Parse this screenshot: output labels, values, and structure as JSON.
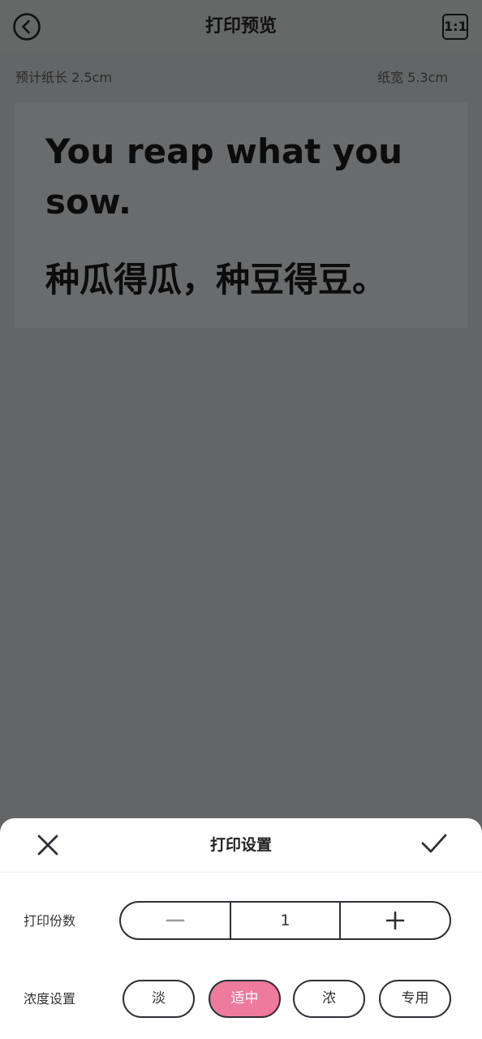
{
  "header": {
    "title": "打印预览",
    "ratio_label": "1:1"
  },
  "paper": {
    "length_text": "预计纸长 2.5cm",
    "width_text": "纸宽 5.3cm"
  },
  "preview": {
    "english_text": "You reap what you sow.",
    "chinese_text": "种瓜得瓜，种豆得豆。"
  },
  "settings_sheet": {
    "title": "打印设置",
    "copies": {
      "label": "打印份数",
      "value": "1"
    },
    "density": {
      "label": "浓度设置",
      "options": [
        "淡",
        "适中",
        "浓",
        "专用"
      ],
      "selected": "适中",
      "active_color": "#ee7a9d"
    }
  },
  "icons": {
    "back": "back-circle-icon",
    "close": "close-icon",
    "confirm": "check-icon",
    "minus": "minus-icon",
    "plus": "plus-icon"
  }
}
